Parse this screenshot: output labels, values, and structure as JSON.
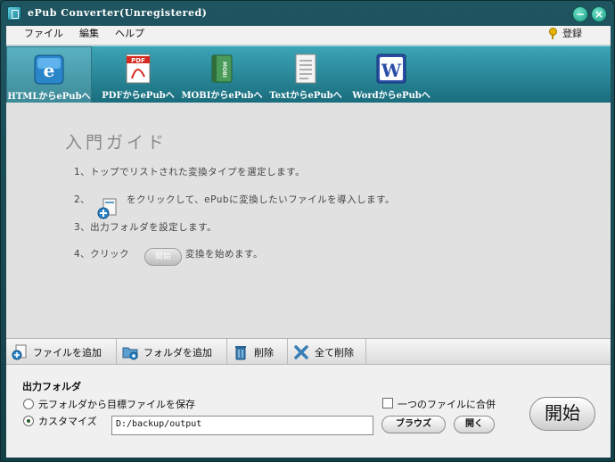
{
  "window": {
    "title": "ePub Converter(Unregistered)"
  },
  "menu": {
    "file": "ファイル",
    "edit": "編集",
    "help": "ヘルプ",
    "register": "登録"
  },
  "tabs": [
    {
      "label": "HTMLからePubへ",
      "icon": "ie-icon"
    },
    {
      "label": "PDFからePubへ",
      "icon": "pdf-icon"
    },
    {
      "label": "MOBIからePubへ",
      "icon": "mobi-book-icon"
    },
    {
      "label": "TextからePubへ",
      "icon": "text-document-icon"
    },
    {
      "label": "WordからePubへ",
      "icon": "word-icon"
    }
  ],
  "guide": {
    "title": "入門ガイド",
    "step1": "1、トップでリストされた変換タイプを選定します。",
    "step2_prefix": "2、",
    "step2_suffix": "をクリックして、ePubに変換したいファイルを導入します。",
    "step3": "3、出力フォルダを設定します。",
    "step4_prefix": "4、クリック",
    "step4_button": "開始",
    "step4_suffix": "変換を始めます。"
  },
  "actions": {
    "add_file": "ファイルを追加",
    "add_folder": "フォルダを追加",
    "delete": "削除",
    "delete_all": "全て削除"
  },
  "output": {
    "title": "出力フォルダ",
    "option_source": "元フォルダから目標ファイルを保存",
    "option_custom": "カスタマイズ",
    "path": "D:/backup/output",
    "merge_label": "一つのファイルに合併",
    "browse": "ブラウズ",
    "open": "開く",
    "start": "開始"
  },
  "colors": {
    "toolbar": "#2b8a9b",
    "titlebar": "#1f5560",
    "content": "#e1e1e1"
  }
}
